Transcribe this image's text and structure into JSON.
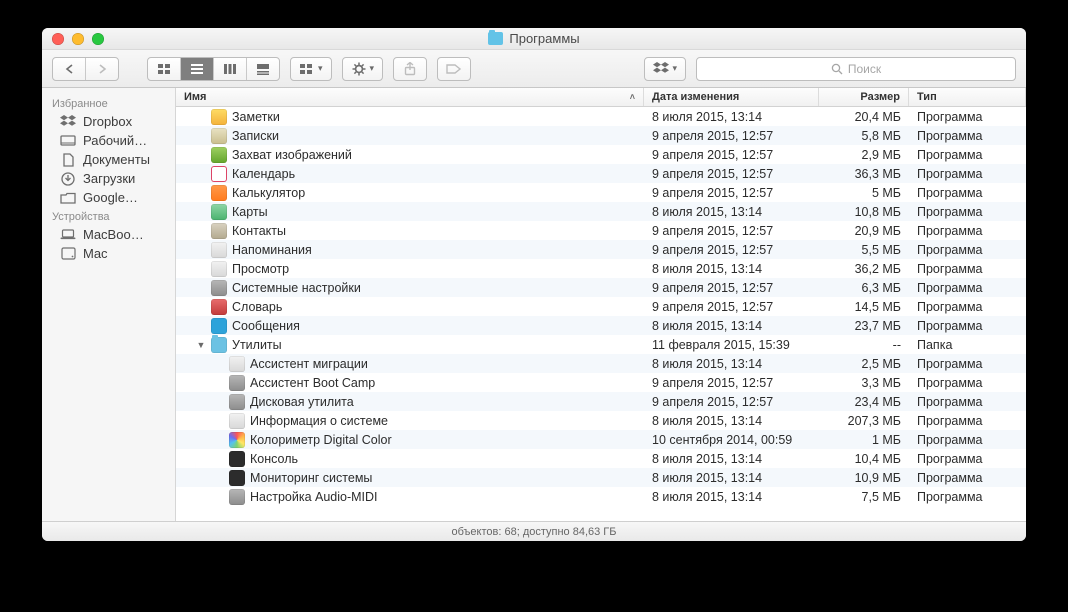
{
  "window": {
    "title": "Программы"
  },
  "toolbar": {
    "dropbox_icon": "dropbox",
    "search_placeholder": "Поиск"
  },
  "sidebar": {
    "sections": [
      {
        "title": "Избранное",
        "items": [
          {
            "icon": "dropbox",
            "label": "Dropbox"
          },
          {
            "icon": "desktop",
            "label": "Рабочий…"
          },
          {
            "icon": "docs",
            "label": "Документы"
          },
          {
            "icon": "downloads",
            "label": "Загрузки"
          },
          {
            "icon": "folder",
            "label": "Google…"
          }
        ]
      },
      {
        "title": "Устройства",
        "items": [
          {
            "icon": "laptop",
            "label": "MacBoo…"
          },
          {
            "icon": "disk",
            "label": "Mac"
          }
        ]
      }
    ]
  },
  "columns": {
    "name": "Имя",
    "date": "Дата изменения",
    "size": "Размер",
    "type": "Тип"
  },
  "rows": [
    {
      "indent": 0,
      "tri": "",
      "ic": "l1",
      "name": "Заметки",
      "date": "8 июля 2015, 13:14",
      "size": "20,4 МБ",
      "type": "Программа"
    },
    {
      "indent": 0,
      "tri": "",
      "ic": "l2",
      "name": "Записки",
      "date": "9 апреля 2015, 12:57",
      "size": "5,8 МБ",
      "type": "Программа"
    },
    {
      "indent": 0,
      "tri": "",
      "ic": "l3",
      "name": "Захват изображений",
      "date": "9 апреля 2015, 12:57",
      "size": "2,9 МБ",
      "type": "Программа"
    },
    {
      "indent": 0,
      "tri": "",
      "ic": "l4",
      "name": "Календарь",
      "date": "9 апреля 2015, 12:57",
      "size": "36,3 МБ",
      "type": "Программа"
    },
    {
      "indent": 0,
      "tri": "",
      "ic": "l5",
      "name": "Калькулятор",
      "date": "9 апреля 2015, 12:57",
      "size": "5 МБ",
      "type": "Программа"
    },
    {
      "indent": 0,
      "tri": "",
      "ic": "l6",
      "name": "Карты",
      "date": "8 июля 2015, 13:14",
      "size": "10,8 МБ",
      "type": "Программа"
    },
    {
      "indent": 0,
      "tri": "",
      "ic": "l7",
      "name": "Контакты",
      "date": "9 апреля 2015, 12:57",
      "size": "20,9 МБ",
      "type": "Программа"
    },
    {
      "indent": 0,
      "tri": "",
      "ic": "l8",
      "name": "Напоминания",
      "date": "9 апреля 2015, 12:57",
      "size": "5,5 МБ",
      "type": "Программа"
    },
    {
      "indent": 0,
      "tri": "",
      "ic": "l8",
      "name": "Просмотр",
      "date": "8 июля 2015, 13:14",
      "size": "36,2 МБ",
      "type": "Программа"
    },
    {
      "indent": 0,
      "tri": "",
      "ic": "l9",
      "name": "Системные настройки",
      "date": "9 апреля 2015, 12:57",
      "size": "6,3 МБ",
      "type": "Программа"
    },
    {
      "indent": 0,
      "tri": "",
      "ic": "l10",
      "name": "Словарь",
      "date": "9 апреля 2015, 12:57",
      "size": "14,5 МБ",
      "type": "Программа"
    },
    {
      "indent": 0,
      "tri": "",
      "ic": "l11",
      "name": "Сообщения",
      "date": "8 июля 2015, 13:14",
      "size": "23,7 МБ",
      "type": "Программа"
    },
    {
      "indent": 0,
      "tri": "▼",
      "ic": "fold",
      "name": "Утилиты",
      "date": "11 февраля 2015, 15:39",
      "size": "--",
      "type": "Папка"
    },
    {
      "indent": 1,
      "tri": "",
      "ic": "l8",
      "name": "Ассистент миграции",
      "date": "8 июля 2015, 13:14",
      "size": "2,5 МБ",
      "type": "Программа"
    },
    {
      "indent": 1,
      "tri": "",
      "ic": "l9",
      "name": "Ассистент Boot Camp",
      "date": "9 апреля 2015, 12:57",
      "size": "3,3 МБ",
      "type": "Программа"
    },
    {
      "indent": 1,
      "tri": "",
      "ic": "l9",
      "name": "Дисковая утилита",
      "date": "9 апреля 2015, 12:57",
      "size": "23,4 МБ",
      "type": "Программа"
    },
    {
      "indent": 1,
      "tri": "",
      "ic": "l8",
      "name": "Информация о системе",
      "date": "8 июля 2015, 13:14",
      "size": "207,3 МБ",
      "type": "Программа"
    },
    {
      "indent": 1,
      "tri": "",
      "ic": "l12",
      "name": "Колориметр Digital Color",
      "date": "10 сентября 2014, 00:59",
      "size": "1 МБ",
      "type": "Программа"
    },
    {
      "indent": 1,
      "tri": "",
      "ic": "dark",
      "name": "Консоль",
      "date": "8 июля 2015, 13:14",
      "size": "10,4 МБ",
      "type": "Программа"
    },
    {
      "indent": 1,
      "tri": "",
      "ic": "dark",
      "name": "Мониторинг системы",
      "date": "8 июля 2015, 13:14",
      "size": "10,9 МБ",
      "type": "Программа"
    },
    {
      "indent": 1,
      "tri": "",
      "ic": "l9",
      "name": "Настройка Audio-MIDI",
      "date": "8 июля 2015, 13:14",
      "size": "7,5 МБ",
      "type": "Программа"
    }
  ],
  "status": "объектов: 68; доступно 84,63 ГБ"
}
